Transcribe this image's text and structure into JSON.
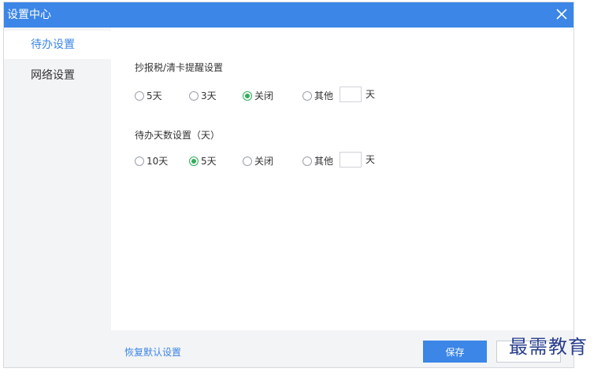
{
  "window": {
    "title": "设置中心"
  },
  "sidebar": {
    "items": [
      {
        "label": "待办设置",
        "active": true
      },
      {
        "label": "网络设置",
        "active": false
      }
    ]
  },
  "sections": [
    {
      "title": "抄报税/清卡提醒设置",
      "options": [
        {
          "label": "5天",
          "checked": false
        },
        {
          "label": "3天",
          "checked": false
        },
        {
          "label": "关闭",
          "checked": true
        },
        {
          "label": "其他",
          "checked": false
        }
      ],
      "custom_value": "",
      "unit": "天"
    },
    {
      "title": "待办天数设置（天）",
      "options": [
        {
          "label": "10天",
          "checked": false
        },
        {
          "label": "5天",
          "checked": true
        },
        {
          "label": "关闭",
          "checked": false
        },
        {
          "label": "其他",
          "checked": false
        }
      ],
      "custom_value": "",
      "unit": "天"
    }
  ],
  "footer": {
    "restore_label": "恢复默认设置",
    "save_label": "保存",
    "cancel_label": ""
  },
  "watermark": "最需教育",
  "colors": {
    "accent": "#3b86e6",
    "radio_checked": "#2fae5a",
    "sidebar_bg": "#f3f4f6"
  },
  "icons": {
    "close": "close-icon"
  }
}
